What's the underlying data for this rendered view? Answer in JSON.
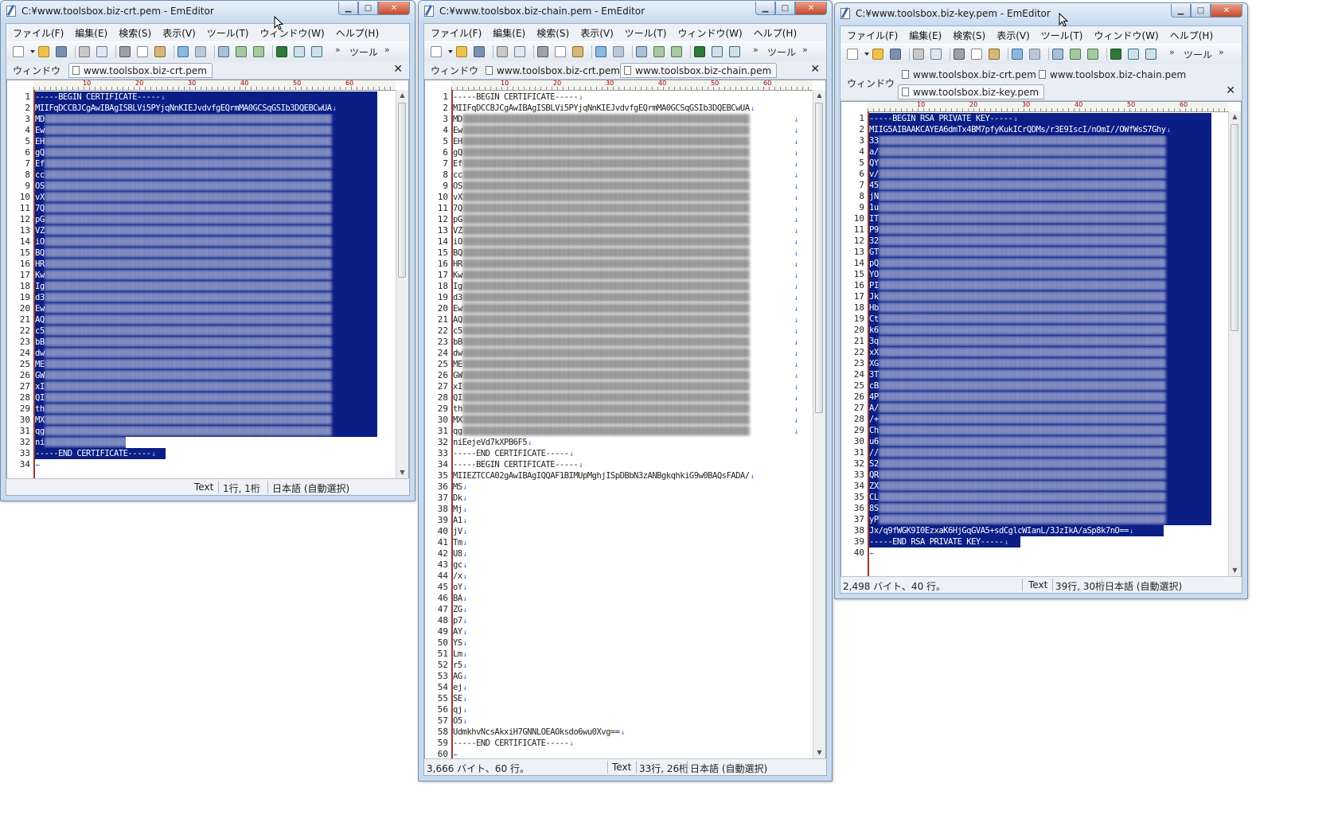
{
  "colors": {
    "selection": "#0a1e86",
    "eol_mark": "#1f6fd6",
    "gutter_border": "#9a3a2a",
    "close_button": "#c44a2c"
  },
  "windows": {
    "w1": {
      "title": "C:¥www.toolsbox.biz-crt.pem - EmEditor",
      "window_list_label": "ウィンドウ",
      "tabs": [
        {
          "label": "www.toolsbox.biz-crt.pem",
          "active": true
        }
      ],
      "status": {
        "text_mode": "Text",
        "position": "1行, 1桁",
        "encoding": "日本語 (自動選択)"
      },
      "lines": {
        "l1": "-----BEGIN CERTIFICATE-----",
        "l2": "MIIFqDCCBJCgAwIBAgISBLVi5PYjqNnKIEJvdvfgEQrmMA0GCSqGSIb3DQEBCwUA",
        "l3": "MD",
        "l4": "Ew",
        "l5": "EH",
        "l6": "gQ",
        "l7": "Ef",
        "l8": "cc",
        "l9": "OS",
        "l10": "vX",
        "l11": "7Q",
        "l12": "pG",
        "l13": "VZ",
        "l14": "iO",
        "l15": "BQ",
        "l16": "HR",
        "l17": "Kw",
        "l18": "Ig",
        "l19": "d3",
        "l20": "Ew",
        "l21": "AQ",
        "l22": "c5",
        "l23": "bB",
        "l24": "dw",
        "l25": "ME",
        "l26": "GW",
        "l27": "xI",
        "l28": "QI",
        "l29": "th",
        "l30": "MX",
        "l31": "qg",
        "l32": "ni",
        "l33": "-----END CERTIFICATE-----",
        "l34": ""
      }
    },
    "w2": {
      "title": "C:¥www.toolsbox.biz-chain.pem - EmEditor",
      "window_list_label": "ウィンドウ",
      "tabs": [
        {
          "label": "www.toolsbox.biz-crt.pem",
          "active": false
        },
        {
          "label": "www.toolsbox.biz-chain.pem",
          "active": true
        }
      ],
      "status": {
        "size": "3,666 バイト、60 行。",
        "text_mode": "Text",
        "position": "33行, 26桁",
        "encoding": "日本語 (自動選択)"
      },
      "lines": {
        "l1": "-----BEGIN CERTIFICATE-----",
        "l2": "MIIFqDCCBJCgAwIBAgISBLVi5PYjqNnKIEJvdvfgEQrmMA0GCSqGSIb3DQEBCwUA",
        "l3": "MD",
        "l4": "Ew",
        "l5": "EH",
        "l6": "gQ",
        "l7": "Ef",
        "l8": "cc",
        "l9": "OS",
        "l10": "vX",
        "l11": "7Q",
        "l12": "pG",
        "l13": "VZ",
        "l14": "iO",
        "l15": "BQ",
        "l16": "HR",
        "l17": "Kw",
        "l18": "Ig",
        "l19": "d3",
        "l20": "Ew",
        "l21": "AQ",
        "l22": "c5",
        "l23": "bB",
        "l24": "dw",
        "l25": "ME",
        "l26": "GW",
        "l27": "xI",
        "l28": "QI",
        "l29": "th",
        "l30": "MX",
        "l31": "qg",
        "l32": "niEejeVd7kXPB6F5",
        "l33": "-----END CERTIFICATE-----",
        "l34": "-----BEGIN CERTIFICATE-----",
        "l35": "MIIEZTCCA02gAwIBAgIQQAF1BIMUpMghjISpDBbN3zANBgkqhkiG9w0BAQsFADA/",
        "l36": "MS",
        "l37": "Dk",
        "l38": "Mj",
        "l39": "A1",
        "l40": "jV",
        "l41": "Tm",
        "l42": "U8",
        "l43": "gc",
        "l44": "/x",
        "l45": "oY",
        "l46": "BA",
        "l47": "ZG",
        "l48": "p7",
        "l49": "AY",
        "l50": "YS",
        "l51": "Lm",
        "l52": "r5",
        "l53": "AG",
        "l54": "ej",
        "l55": "SE",
        "l56": "qj",
        "l57": "O5",
        "l58": "UdmkhvNcsAkxiH7GNNLOEAOksdo6wu0Xvg==",
        "l59": "-----END CERTIFICATE-----",
        "l60": ""
      }
    },
    "w3": {
      "title": "C:¥www.toolsbox.biz-key.pem - EmEditor",
      "window_list_label": "ウィンドウ",
      "tabs": [
        {
          "label": "www.toolsbox.biz-crt.pem",
          "active": false
        },
        {
          "label": "www.toolsbox.biz-chain.pem",
          "active": false
        },
        {
          "label": "www.toolsbox.biz-key.pem",
          "active": true
        }
      ],
      "status": {
        "size": "2,498 バイト、40 行。",
        "text_mode": "Text",
        "position": "39行, 30桁",
        "encoding": "日本語 (自動選択)"
      },
      "lines": {
        "l1": "-----BEGIN RSA PRIVATE KEY-----",
        "l2": "MIIG5AIBAAKCAYEA6dmTx4BM7pfyKukICrQDMs/r3E9IscI/nOmI//OWfWsS7Ghy",
        "l3": "33",
        "l4": "a/",
        "l5": "QY",
        "l6": "v/",
        "l7": "45",
        "l8": "jN",
        "l9": "1u",
        "l10": "IT",
        "l11": "P9",
        "l12": "32",
        "l13": "GT",
        "l14": "pQ",
        "l15": "YO",
        "l16": "PI",
        "l17": "Jk",
        "l18": "Hb",
        "l19": "Ct",
        "l20": "k6",
        "l21": "3q",
        "l22": "xX",
        "l23": "XG",
        "l24": "3T",
        "l25": "cB",
        "l26": "4P",
        "l27": "A/",
        "l28": "/+",
        "l29": "Ch",
        "l30": "u6",
        "l31": "//",
        "l32": "S2",
        "l33": "QR",
        "l34": "ZX",
        "l35": "CL",
        "l36": "8S",
        "l37": "yP",
        "l38": "Jx/q9fWGK9I0EzxaK6HjGqGVA5+sdCglcWIanL/3JzIkA/aSp8k7nO==",
        "l39": "-----END RSA PRIVATE KEY-----",
        "l40": ""
      }
    }
  },
  "menu": {
    "file": "ファイル(F)",
    "edit": "編集(E)",
    "search": "検索(S)",
    "view": "表示(V)",
    "tools": "ツール(T)",
    "window": "ウィンドウ(W)",
    "help": "ヘルプ(H)"
  },
  "toolbar": {
    "tools_label": "ツール",
    "more": "»"
  },
  "ruler_nums": [
    "10",
    "20",
    "30",
    "40",
    "50",
    "60"
  ]
}
